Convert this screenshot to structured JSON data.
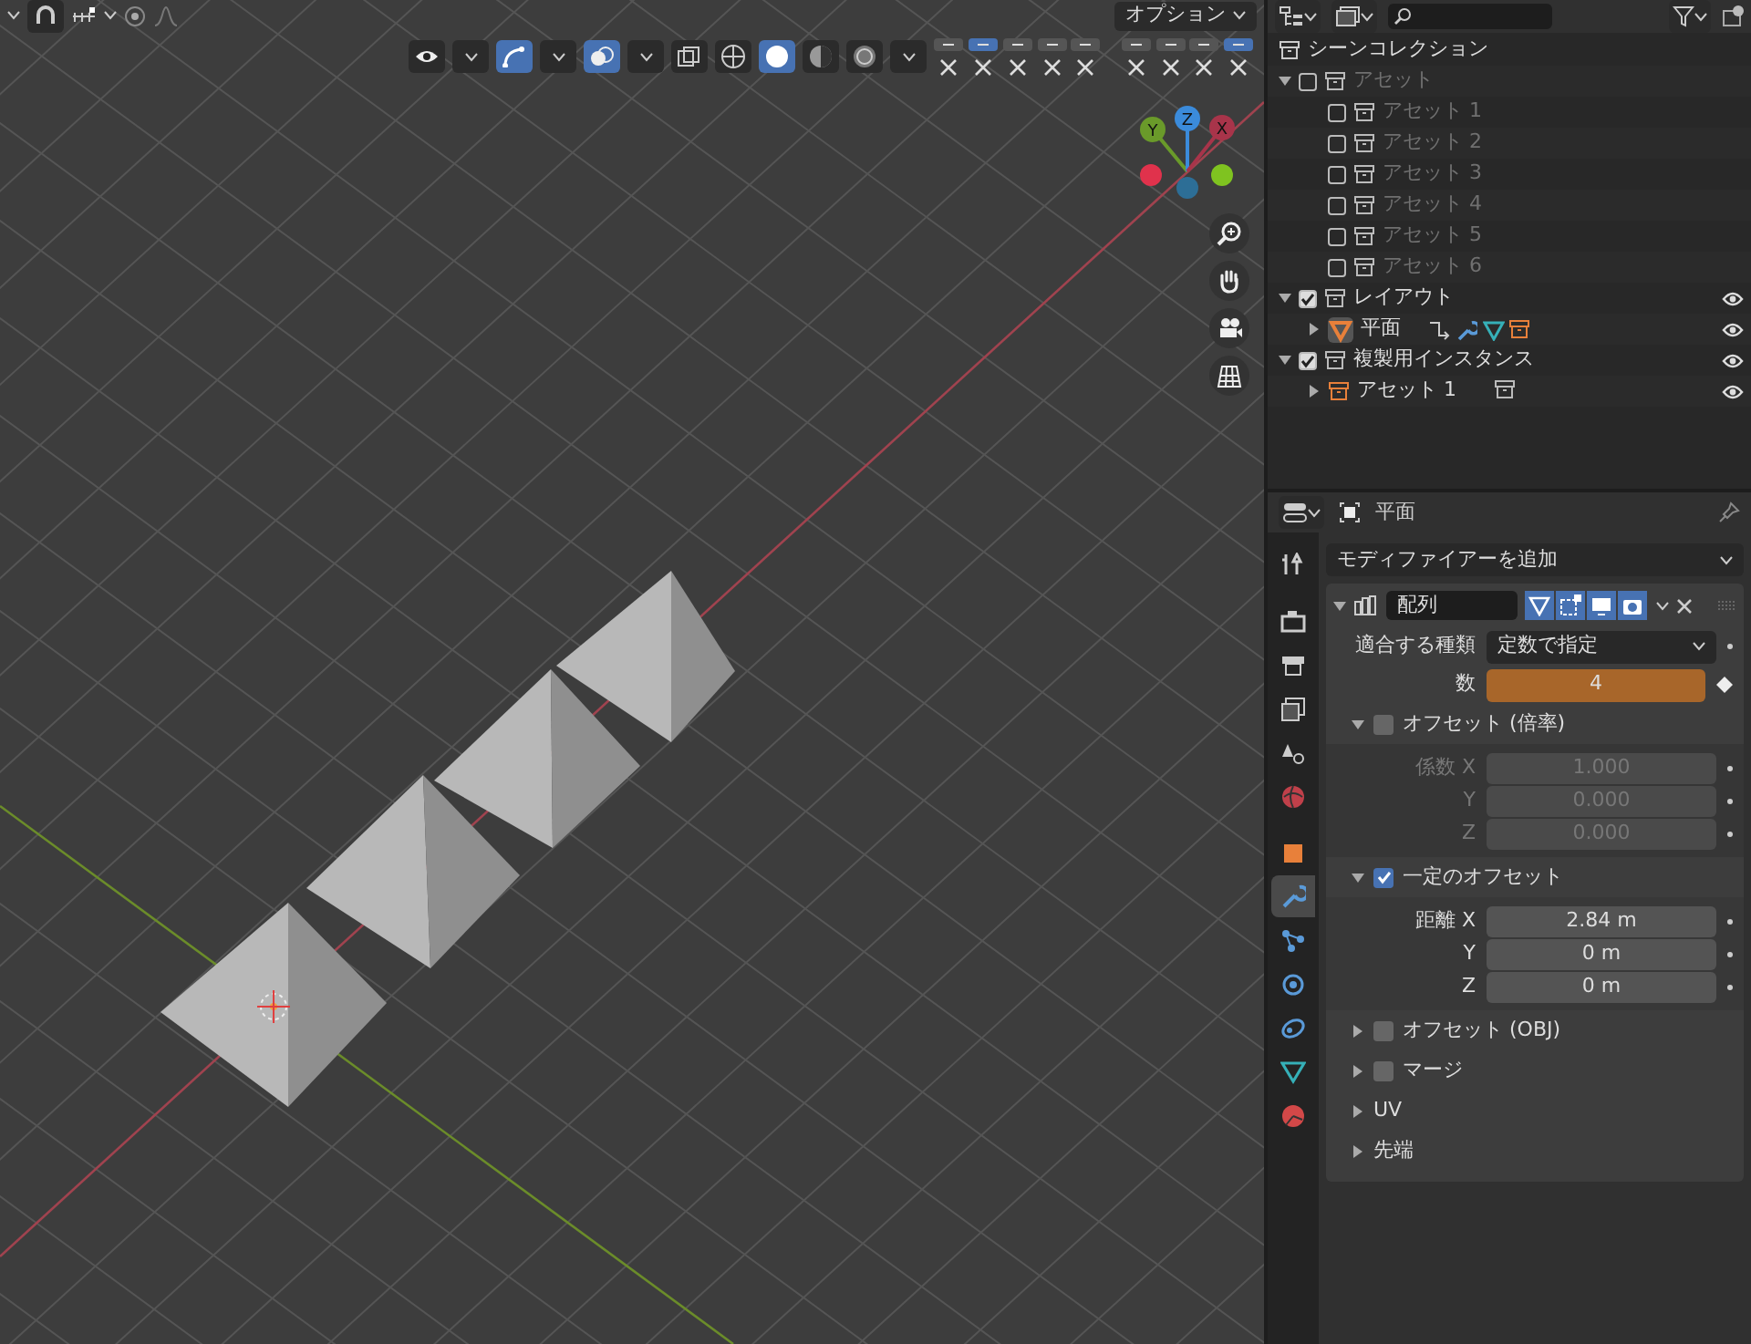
{
  "viewport": {
    "options_label": "オプション",
    "toggles": [
      {
        "kind": "visibility",
        "on": false
      },
      {
        "kind": "gizmo",
        "on": true
      },
      {
        "kind": "overlay",
        "on": true
      },
      {
        "kind": "xray",
        "on": false
      }
    ],
    "shading_modes": [
      {
        "kind": "wireframe",
        "selected": false
      },
      {
        "kind": "solid",
        "selected": true
      },
      {
        "kind": "material",
        "selected": false
      },
      {
        "kind": "rendered",
        "selected": false
      }
    ],
    "layer_toggles": [
      {
        "on": false
      },
      {
        "on": true
      },
      {
        "on": false
      },
      {
        "on": false
      },
      {
        "on": false
      },
      {
        "on": false
      },
      {
        "on": false
      },
      {
        "on": false
      },
      {
        "on": true
      }
    ],
    "gizmo_axes": [
      {
        "label": "Y",
        "color": "#6a9a2a"
      },
      {
        "label": "Z",
        "color": "#3b8bdb"
      },
      {
        "label": "X",
        "color": "#a8344a"
      }
    ]
  },
  "outliner": {
    "tree": [
      {
        "kind": "scene",
        "label": "シーンコレクション",
        "children": [
          {
            "kind": "collection",
            "label": "アセット",
            "expanded": true,
            "checked": false,
            "visible": false,
            "children": [
              {
                "kind": "collection",
                "label": "アセット 1",
                "checked": false,
                "visible": false
              },
              {
                "kind": "collection",
                "label": "アセット 2",
                "checked": false,
                "visible": false
              },
              {
                "kind": "collection",
                "label": "アセット 3",
                "checked": false,
                "visible": false
              },
              {
                "kind": "collection",
                "label": "アセット 4",
                "checked": false,
                "visible": false
              },
              {
                "kind": "collection",
                "label": "アセット 5",
                "checked": false,
                "visible": false
              },
              {
                "kind": "collection",
                "label": "アセット 6",
                "checked": false,
                "visible": false
              }
            ]
          },
          {
            "kind": "collection",
            "label": "レイアウト",
            "expanded": true,
            "checked": true,
            "visible": true,
            "children": [
              {
                "kind": "mesh_object",
                "label": "平面",
                "expanded": false,
                "visible": true
              }
            ]
          },
          {
            "kind": "collection",
            "label": "複製用インスタンス",
            "expanded": true,
            "checked": true,
            "visible": true,
            "children": [
              {
                "kind": "instance",
                "label": "アセット 1",
                "expanded": false,
                "visible": true
              }
            ]
          }
        ]
      }
    ]
  },
  "properties": {
    "object_name": "平面",
    "add_modifier": "モディファイアーを追加",
    "tabs": [
      {
        "kind": "tool",
        "selected": false
      },
      {
        "kind": "render",
        "selected": false
      },
      {
        "kind": "output",
        "selected": false
      },
      {
        "kind": "view_layer",
        "selected": false
      },
      {
        "kind": "scene",
        "selected": false
      },
      {
        "kind": "world",
        "selected": false
      },
      {
        "kind": "object",
        "selected": false
      },
      {
        "kind": "modifiers",
        "selected": true
      },
      {
        "kind": "particles",
        "selected": false
      },
      {
        "kind": "physics",
        "selected": false
      },
      {
        "kind": "constraints",
        "selected": false
      },
      {
        "kind": "data",
        "selected": false
      },
      {
        "kind": "material",
        "selected": false
      }
    ],
    "modifier": {
      "name": "配列",
      "expanded": true,
      "toggles": [
        {
          "kind": "edit_mode",
          "on": true
        },
        {
          "kind": "cage",
          "on": true
        },
        {
          "kind": "realtime",
          "on": true
        },
        {
          "kind": "render",
          "on": true
        }
      ],
      "fit_type": {
        "label": "適合する種類",
        "value": "定数で指定"
      },
      "count": {
        "label": "数",
        "value": "4"
      },
      "sections": [
        {
          "label": "オフセット (倍率)",
          "kind": "checkbox",
          "checked": false,
          "expanded": true,
          "rows": [
            {
              "label": "係数 X",
              "value": "1.000"
            },
            {
              "label": "Y",
              "value": "0.000"
            },
            {
              "label": "Z",
              "value": "0.000"
            }
          ]
        },
        {
          "label": "一定のオフセット",
          "kind": "checkbox",
          "checked": true,
          "expanded": true,
          "rows": [
            {
              "label": "距離 X",
              "value": "2.84 m"
            },
            {
              "label": "Y",
              "value": "0 m"
            },
            {
              "label": "Z",
              "value": "0 m"
            }
          ]
        },
        {
          "label": "オフセット (OBJ)",
          "kind": "checkbox",
          "checked": false,
          "expanded": false
        },
        {
          "label": "マージ",
          "kind": "checkbox",
          "checked": false,
          "expanded": false
        },
        {
          "label": "UV",
          "kind": "plain",
          "expanded": false
        },
        {
          "label": "先端",
          "kind": "plain",
          "expanded": false
        }
      ]
    }
  }
}
